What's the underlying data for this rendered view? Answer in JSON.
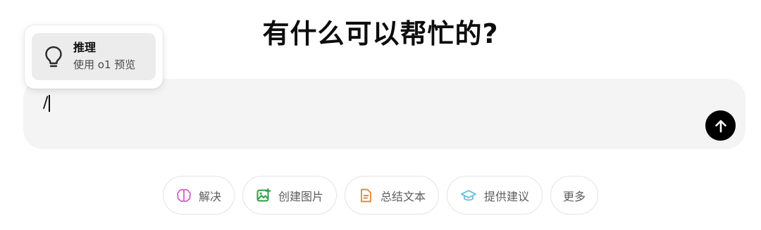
{
  "heading": "有什么可以帮忙的?",
  "composer": {
    "value": "/"
  },
  "popup": {
    "items": [
      {
        "icon": "lightbulb-icon",
        "title": "推理",
        "subtitle": "使用 o1 预览"
      }
    ]
  },
  "suggestions": [
    {
      "icon": "brain-icon",
      "label": "解决",
      "color": "#d85fc7"
    },
    {
      "icon": "image-create-icon",
      "label": "创建图片",
      "color": "#2e9e44"
    },
    {
      "icon": "document-icon",
      "label": "总结文本",
      "color": "#e58a3a"
    },
    {
      "icon": "graduation-cap-icon",
      "label": "提供建议",
      "color": "#6cc3d9"
    }
  ],
  "more_label": "更多",
  "send_icon": "arrow-up-icon",
  "colors": {
    "composer_bg": "#f4f4f4",
    "send_bg": "#000000",
    "popup_item_bg": "#ececec"
  }
}
